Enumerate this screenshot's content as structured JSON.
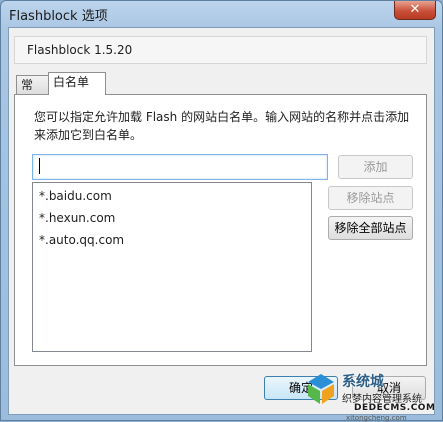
{
  "window": {
    "title": "Flashblock 选项",
    "close_glyph": "✕"
  },
  "header": {
    "version": "Flashblock 1.5.20"
  },
  "tabs": [
    {
      "label": "常规",
      "active": false
    },
    {
      "label": "白名单",
      "active": true
    }
  ],
  "whitelist": {
    "description": "您可以指定允许加载 Flash 的网站白名单。输入网站的名称并点击添加来添加它到白名单。",
    "input_value": "",
    "add_label": "添加",
    "remove_label": "移除站点",
    "remove_all_label": "移除全部站点",
    "sites": [
      "*.baidu.com",
      "*.hexun.com",
      "*.auto.qq.com"
    ]
  },
  "footer": {
    "ok_label": "确定",
    "cancel_label": "取消"
  },
  "watermark": {
    "brand": "系统城",
    "sub": "织梦内容管理系统",
    "url": "DEDECMS.COM",
    "tiny": "xitongcheng.com"
  },
  "colors": {
    "title_bar": "#a9c6e4",
    "close_button": "#c9503a",
    "focus_border": "#3c7fb1"
  }
}
